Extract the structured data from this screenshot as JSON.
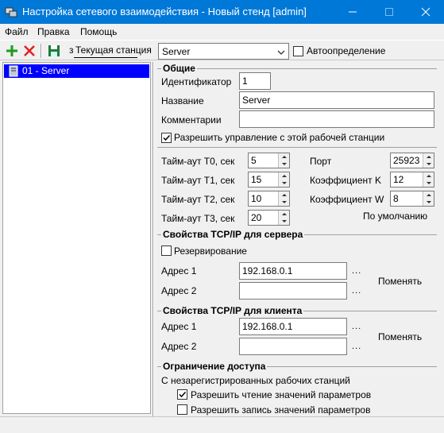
{
  "window": {
    "title": "Настройка сетевого взаимодействия - Новый стенд [admin]"
  },
  "menu": {
    "file": "Файл",
    "edit": "Правка",
    "help": "Помощь"
  },
  "toolbar": {
    "station_label": "Текущая станция",
    "station_prefix": "з",
    "station_value": "Server",
    "auto_detect_label": "Автоопределение",
    "auto_detect_checked": false
  },
  "tree": {
    "items": [
      {
        "label": "01 - Server",
        "selected": true
      }
    ]
  },
  "general": {
    "title": "Общие",
    "id_label": "Идентификатор",
    "id_value": "1",
    "name_label": "Название",
    "name_value": "Server",
    "comments_label": "Комментарии",
    "comments_value": "",
    "allow_control_label": "Разрешить управление с этой рабочей станции",
    "allow_control_checked": true
  },
  "timeouts": {
    "t0_label": "Тайм-аут T0, сек",
    "t0_value": "5",
    "t1_label": "Тайм-аут T1, сек",
    "t1_value": "15",
    "t2_label": "Тайм-аут T2, сек",
    "t2_value": "10",
    "t3_label": "Тайм-аут T3, сек",
    "t3_value": "20",
    "port_label": "Порт",
    "port_value": "25923",
    "k_label": "Коэффициент K",
    "k_value": "12",
    "w_label": "Коэффициент W",
    "w_value": "8",
    "defaults_link": "По умолчанию"
  },
  "server_tcp": {
    "title": "Свойства TCP/IP для сервера",
    "backup_label": "Резервирование",
    "backup_checked": false,
    "addr1_label": "Адрес 1",
    "addr1_value": "192.168.0.1",
    "addr2_label": "Адрес 2",
    "addr2_value": "",
    "dots": "...",
    "change_label": "Поменять"
  },
  "client_tcp": {
    "title": "Свойства TCP/IP для клиента",
    "addr1_label": "Адрес 1",
    "addr1_value": "192.168.0.1",
    "addr2_label": "Адрес 2",
    "addr2_value": "",
    "dots": "...",
    "change_label": "Поменять"
  },
  "access": {
    "title": "Ограничение доступа",
    "subtitle": "С незарегистрированных рабочих станций",
    "read_label": "Разрешить чтение значений параметров",
    "read_checked": true,
    "write_label": "Разрешить запись значений параметров",
    "write_checked": false
  },
  "colors": {
    "titlebar": "#0078d7",
    "selection": "#0000ff",
    "add": "#1a9e1a",
    "delete": "#e02020",
    "save": "#1f7a3a"
  }
}
